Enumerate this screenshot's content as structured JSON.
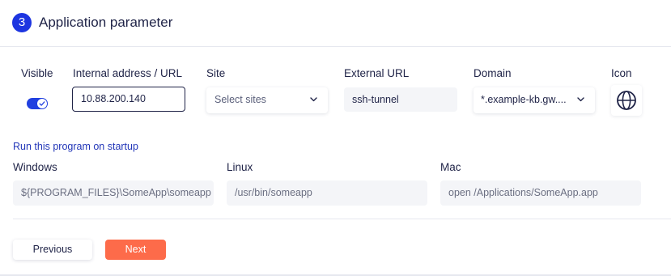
{
  "header": {
    "step_number": "3",
    "title": "Application parameter"
  },
  "fields": {
    "visible": {
      "label": "Visible",
      "checked": true
    },
    "internal_url": {
      "label": "Internal address / URL",
      "value": "10.88.200.140"
    },
    "site": {
      "label": "Site",
      "placeholder": "Select sites"
    },
    "external_url": {
      "label": "External URL",
      "value": "ssh-tunnel"
    },
    "domain": {
      "label": "Domain",
      "value": "*.example-kb.gw...."
    },
    "icon": {
      "label": "Icon",
      "icon_name": "globe-icon"
    }
  },
  "startup": {
    "link_label": "Run this program on startup",
    "windows": {
      "label": "Windows",
      "value": "${PROGRAM_FILES}\\SomeApp\\someapp"
    },
    "linux": {
      "label": "Linux",
      "value": "/usr/bin/someapp"
    },
    "mac": {
      "label": "Mac",
      "value": "open /Applications/SomeApp.app"
    }
  },
  "buttons": {
    "previous": "Previous",
    "next": "Next"
  },
  "colors": {
    "accent": "#1d35e0",
    "next_button": "#fd6b4a",
    "text": "#1f2347",
    "link": "#2236b8"
  }
}
